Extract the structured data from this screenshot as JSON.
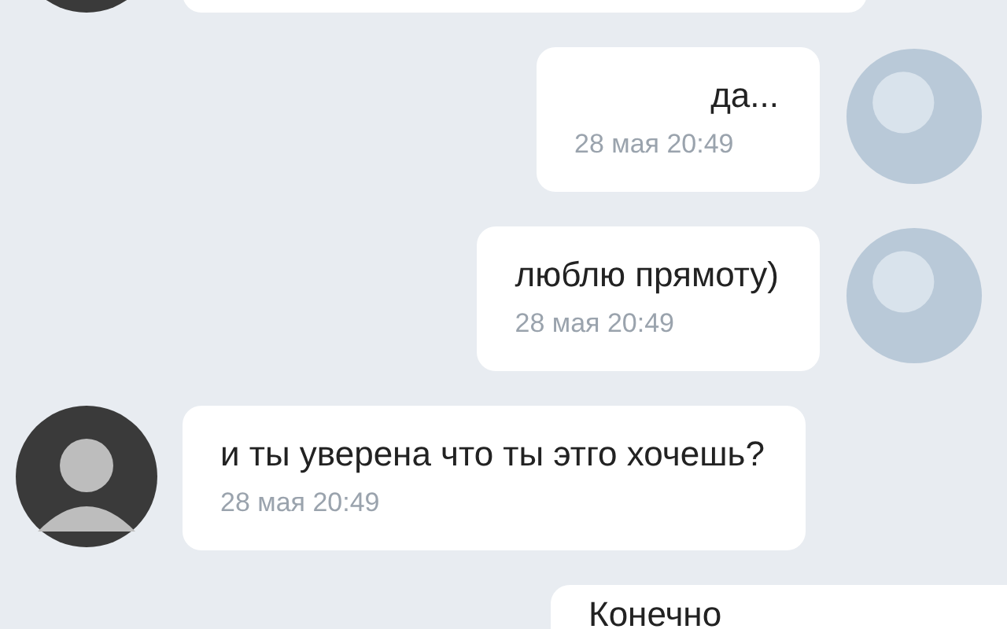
{
  "messages": [
    {
      "kind": "incoming"
    },
    {
      "kind": "outgoing",
      "text": "да...",
      "time": "28 мая 20:49"
    },
    {
      "kind": "outgoing",
      "text": "люблю прямоту)",
      "time": "28 мая 20:49"
    },
    {
      "kind": "incoming",
      "text": "и ты уверена что ты этго хочешь?",
      "time": "28 мая 20:49"
    },
    {
      "kind": "outgoing",
      "text": "Конечно"
    }
  ]
}
